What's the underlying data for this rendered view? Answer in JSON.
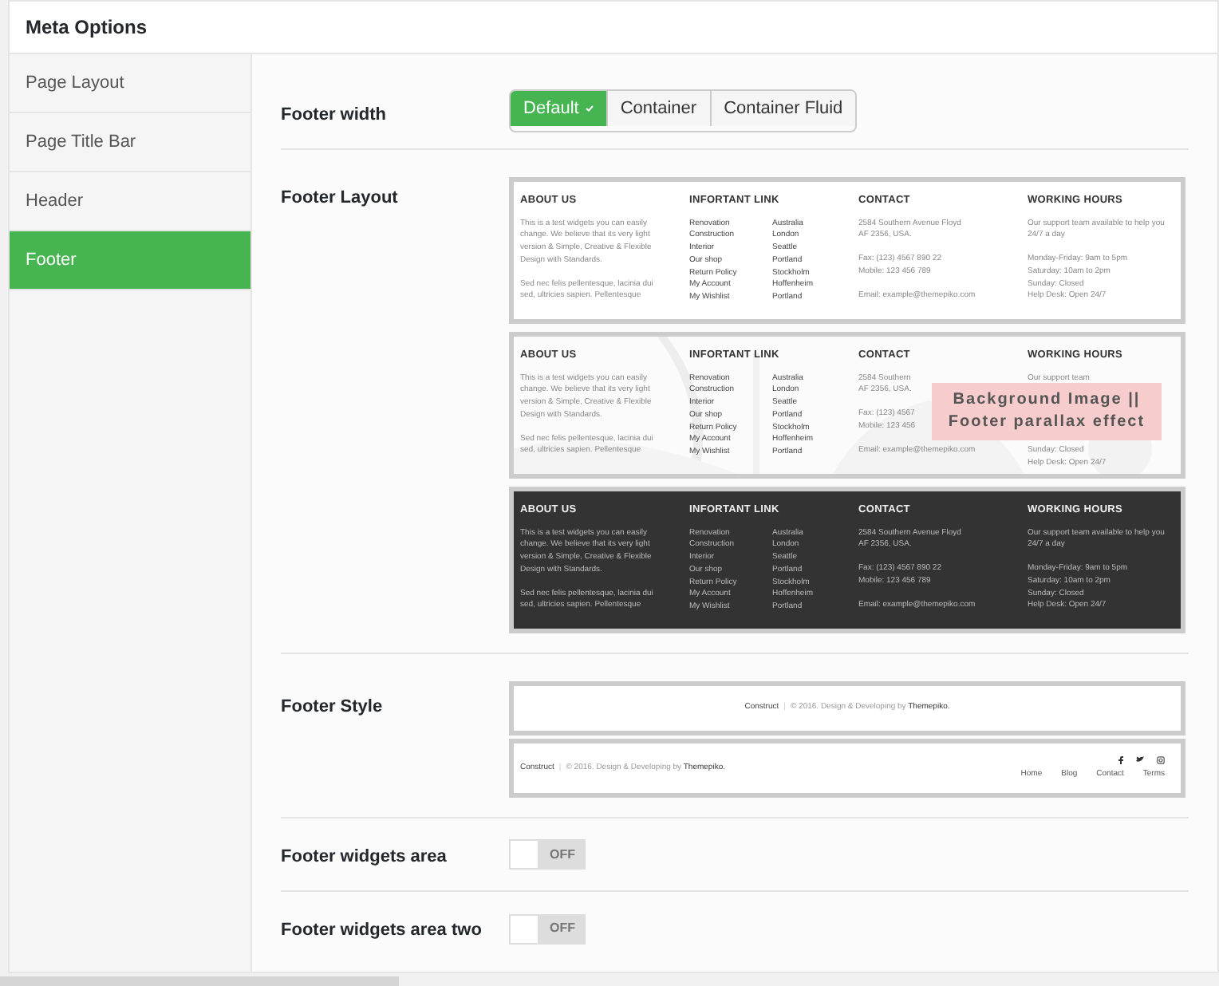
{
  "title": "Meta Options",
  "sidebar": [
    {
      "label": "Page Layout",
      "selected": false
    },
    {
      "label": "Page Title Bar",
      "selected": false
    },
    {
      "label": "Header",
      "selected": false
    },
    {
      "label": "Footer",
      "selected": true
    }
  ],
  "footer_width": {
    "label": "Footer width",
    "options": [
      {
        "label": "Default",
        "selected": true
      },
      {
        "label": "Container",
        "selected": false
      },
      {
        "label": "Container Fluid",
        "selected": false
      }
    ]
  },
  "footer_layout": {
    "label": "Footer Layout",
    "thumbnails": [
      {
        "kind": "light",
        "columns": [
          {
            "kind": "text",
            "heading": "ABOUT US",
            "paragraphs": [
              [
                "This is a test widgets you can easily",
                "change. We believe that its very light",
                "version & Simple, Creative & Flexible",
                "Design with Standards."
              ],
              [
                "Sed nec felis pellentesque, lacinia dui",
                "sed, ultricies sapien. Pellentesque"
              ]
            ]
          },
          {
            "kind": "links",
            "heading": "INFORTANT LINK",
            "links": [
              [
                "Renovation",
                "Construction",
                "Interior",
                "Our shop",
                "Return Policy",
                "My Account",
                "My Wishlist"
              ],
              [
                "Australia",
                "London",
                "Seattle",
                "Portland",
                "Stockholm",
                "Hoffenheim",
                "Portland"
              ]
            ]
          },
          {
            "kind": "text",
            "heading": "CONTACT",
            "paragraphs": [
              [
                "2584 Southern Avenue Floyd",
                "AF 2356, USA."
              ],
              [
                "Fax: (123) 4567 890 22",
                "Mobile: 123 456 789"
              ],
              [
                "Email: example@themepiko.com"
              ]
            ]
          },
          {
            "kind": "text",
            "heading": "WORKING HOURS",
            "paragraphs": [
              [
                "Our support team available to help you",
                "24/7 a day"
              ],
              [
                "Monday-Friday: 9am to 5pm",
                "Saturday: 10am to 2pm",
                "Sunday: Closed",
                "Help Desk: Open 24/7"
              ]
            ]
          }
        ]
      },
      {
        "overlay": [
          "Background Image ||",
          "Footer parallax effect"
        ],
        "columns": [
          {
            "kind": "text",
            "heading": "ABOUT US",
            "paragraphs": [
              [
                "This is a test widgets you can easily",
                "change. We believe that its very light",
                "version & Simple, Creative & Flexible",
                "Design with Standards."
              ],
              [
                "Sed nec felis pellentesque, lacinia dui",
                "sed, ultricies sapien. Pellentesque"
              ]
            ]
          },
          {
            "kind": "links",
            "heading": "INFORTANT LINK",
            "links": [
              [
                "Renovation",
                "Construction",
                "Interior",
                "Our shop",
                "Return Policy",
                "My Account",
                "My Wishlist"
              ],
              [
                "Australia",
                "London",
                "Seattle",
                "Portland",
                "Stockholm",
                "Hoffenheim",
                "Portland"
              ]
            ]
          },
          {
            "kind": "text",
            "heading": "CONTACT",
            "paragraphs": [
              [
                "2584 Southern",
                "AF 2356, USA."
              ],
              [
                "Fax: (123) 4567",
                "Mobile: 123 456"
              ],
              [
                "Email: example@themepiko.com"
              ]
            ]
          },
          {
            "kind": "text",
            "heading": "WORKING HOURS",
            "paragraphs": [
              [
                "Our support team"
              ],
              [
                "Sunday: Closed",
                "Help Desk: Open 24/7"
              ]
            ]
          }
        ]
      },
      {
        "kind": "dark",
        "columns": [
          {
            "kind": "text",
            "heading": "ABOUT US",
            "paragraphs": [
              [
                "This is a test widgets you can easily",
                "change. We believe that its very light",
                "version & Simple, Creative & Flexible",
                "Design with Standards."
              ],
              [
                "Sed nec felis pellentesque, lacinia dui",
                "sed, ultricies sapien. Pellentesque"
              ]
            ]
          },
          {
            "kind": "links",
            "heading": "INFORTANT LINK",
            "links": [
              [
                "Renovation",
                "Construction",
                "Interior",
                "Our shop",
                "Return Policy",
                "My Account",
                "My Wishlist"
              ],
              [
                "Australia",
                "London",
                "Seattle",
                "Portland",
                "Stockholm",
                "Hoffenheim",
                "Portland"
              ]
            ]
          },
          {
            "kind": "text",
            "heading": "CONTACT",
            "paragraphs": [
              [
                "2584 Southern Avenue Floyd",
                "AF 2356, USA."
              ],
              [
                "Fax: (123) 4567 890 22",
                "Mobile: 123 456 789"
              ],
              [
                "Email: example@themepiko.com"
              ]
            ]
          },
          {
            "kind": "text",
            "heading": "WORKING HOURS",
            "paragraphs": [
              [
                "Our support team available to help you",
                "24/7 a day"
              ],
              [
                "Monday-Friday: 9am to 5pm",
                "Saturday: 10am to 2pm",
                "Sunday: Closed",
                "Help Desk: Open 24/7"
              ]
            ]
          }
        ]
      }
    ]
  },
  "footer_style": {
    "label": "Footer Style",
    "options": [
      {
        "kind": "centered",
        "brand": "Construct",
        "separator": "|",
        "copyright": "© 2016. Design & Developing by",
        "author": "Themepiko."
      },
      {
        "kind": "split",
        "brand": "Construct",
        "separator": "|",
        "copyright": "© 2016. Design & Developing by",
        "author": "Themepiko.",
        "menu": [
          "Home",
          "Blog",
          "Contact",
          "Terms"
        ]
      }
    ]
  },
  "toggles": [
    {
      "label": "Footer widgets area",
      "on": false,
      "state": "OFF"
    },
    {
      "label": "Footer widgets area two",
      "on": false,
      "state": "OFF"
    }
  ]
}
